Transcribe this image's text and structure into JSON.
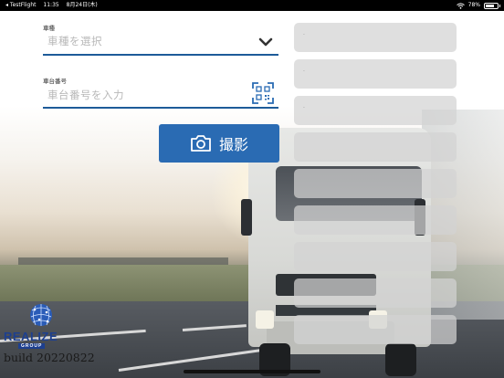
{
  "status_bar": {
    "app": "◂ TestFlight",
    "time": "11:35",
    "date": "8月24日(木)",
    "battery": "78%",
    "battery_level": 0.78
  },
  "form": {
    "vehicle_type": {
      "label": "車種",
      "placeholder": "車種を選択"
    },
    "vehicle_number": {
      "label": "車台番号",
      "placeholder": "車台番号を入力"
    },
    "capture_button": "撮影"
  },
  "right_panels": [
    {
      "label": "."
    },
    {
      "label": "."
    },
    {
      "label": "."
    },
    {
      "label": ""
    },
    {
      "label": ""
    },
    {
      "label": ""
    },
    {
      "label": ""
    },
    {
      "label": ""
    },
    {
      "label": ""
    }
  ],
  "brand": {
    "name": "REALIZE",
    "sub": "GROUP",
    "build": "build 20220822"
  },
  "colors": {
    "accent": "#2a6bb3",
    "underline": "#1e5b99",
    "logo": "#1d3f8f"
  }
}
